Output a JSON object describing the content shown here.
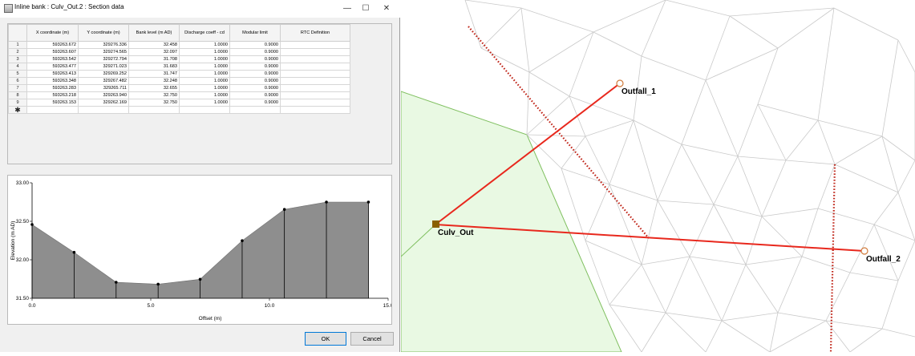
{
  "dialog": {
    "title": "Inline bank : Culv_Out.2 : Section data",
    "minimize": "—",
    "maximize": "☐",
    "close": "✕",
    "ok_label": "OK",
    "cancel_label": "Cancel"
  },
  "grid": {
    "columns": [
      "X coordinate (m)",
      "Y coordinate (m)",
      "Bank level (m AD)",
      "Discharge coeff - cd",
      "Modular limit",
      "RTC Definition"
    ],
    "rows": [
      {
        "n": "1",
        "x": "593263.672",
        "y": "329276.336",
        "level": "32.458",
        "cd": "1.0000",
        "ml": "0.9000",
        "rtc": ""
      },
      {
        "n": "2",
        "x": "593263.607",
        "y": "329274.565",
        "level": "32.097",
        "cd": "1.0000",
        "ml": "0.9000",
        "rtc": ""
      },
      {
        "n": "3",
        "x": "593263.542",
        "y": "329272.794",
        "level": "31.708",
        "cd": "1.0000",
        "ml": "0.9000",
        "rtc": ""
      },
      {
        "n": "4",
        "x": "593263.477",
        "y": "329271.023",
        "level": "31.683",
        "cd": "1.0000",
        "ml": "0.9000",
        "rtc": ""
      },
      {
        "n": "5",
        "x": "593263.413",
        "y": "329269.252",
        "level": "31.747",
        "cd": "1.0000",
        "ml": "0.9000",
        "rtc": ""
      },
      {
        "n": "6",
        "x": "593263.348",
        "y": "329267.482",
        "level": "32.248",
        "cd": "1.0000",
        "ml": "0.9000",
        "rtc": ""
      },
      {
        "n": "7",
        "x": "593263.283",
        "y": "329265.711",
        "level": "32.655",
        "cd": "1.0000",
        "ml": "0.9000",
        "rtc": ""
      },
      {
        "n": "8",
        "x": "593263.218",
        "y": "329263.940",
        "level": "32.750",
        "cd": "1.0000",
        "ml": "0.9000",
        "rtc": ""
      },
      {
        "n": "9",
        "x": "593263.153",
        "y": "329262.169",
        "level": "32.750",
        "cd": "1.0000",
        "ml": "0.9000",
        "rtc": ""
      }
    ],
    "new_row_marker": "✱"
  },
  "chart_data": {
    "type": "area",
    "xlabel": "Offset (m)",
    "ylabel": "Elevation (m AD)",
    "xlim": [
      0,
      15
    ],
    "ylim": [
      31.5,
      33.0
    ],
    "xticks": [
      "0.0",
      "5.0",
      "10.0",
      "15.0"
    ],
    "yticks": [
      "31.50",
      "32.00",
      "32.50",
      "33.00"
    ],
    "series": [
      {
        "x": [
          0.0,
          1.77,
          3.54,
          5.31,
          7.08,
          8.85,
          10.63,
          12.4,
          14.17
        ],
        "values": [
          32.458,
          32.097,
          31.708,
          31.683,
          31.747,
          32.248,
          32.655,
          32.75,
          32.75
        ]
      }
    ],
    "fill_color": "#8e8e8e"
  },
  "map": {
    "labels": {
      "culv_out": "Culv_Out",
      "outfall_1": "Outfall_1",
      "outfall_2": "Outfall_2"
    },
    "colors": {
      "conduit": "#e8281d",
      "bank": "#c0261a",
      "polygon_fill": "#e9f9e3",
      "polygon_edge": "#7fbf5f",
      "mesh": "#c9c9c9",
      "node": "#8a6000"
    }
  }
}
